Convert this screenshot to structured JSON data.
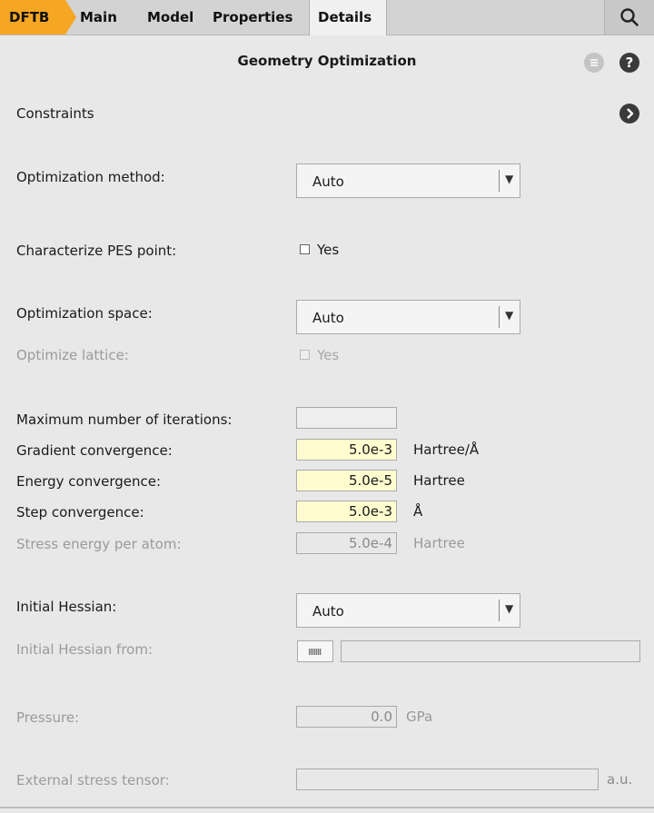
{
  "tabs": {
    "dftb": "DFTB",
    "main": "Main",
    "model": "Model",
    "properties": "Properties",
    "details": "Details"
  },
  "panel": {
    "title": "Geometry Optimization",
    "constraints": "Constraints"
  },
  "fields": {
    "optimization_method": {
      "label": "Optimization method:",
      "value": "Auto"
    },
    "characterize_pes": {
      "label": "Characterize PES point:",
      "checkbox": "Yes",
      "checked": false
    },
    "optimization_space": {
      "label": "Optimization space:",
      "value": "Auto"
    },
    "optimize_lattice": {
      "label": "Optimize lattice:",
      "checkbox": "Yes",
      "checked": false
    },
    "max_iterations": {
      "label": "Maximum number of iterations:",
      "value": ""
    },
    "gradient_convergence": {
      "label": "Gradient convergence:",
      "value": "5.0e-3",
      "unit": "Hartree/Å"
    },
    "energy_convergence": {
      "label": "Energy convergence:",
      "value": "5.0e-5",
      "unit": "Hartree"
    },
    "step_convergence": {
      "label": "Step convergence:",
      "value": "5.0e-3",
      "unit": "Å"
    },
    "stress_energy": {
      "label": "Stress energy per atom:",
      "value": "5.0e-4",
      "unit": "Hartree"
    },
    "initial_hessian": {
      "label": "Initial Hessian:",
      "value": "Auto"
    },
    "initial_hessian_from": {
      "label": "Initial Hessian from:",
      "value": ""
    },
    "pressure": {
      "label": "Pressure:",
      "value": "0.0",
      "unit": "GPa"
    },
    "external_stress": {
      "label": "External stress tensor:",
      "value": "",
      "unit": "a.u."
    }
  },
  "icons": {
    "search": "search-icon",
    "list": "list-icon",
    "help": "help-icon",
    "next": "chevron-right-icon"
  },
  "colors": {
    "accent": "#f5a623",
    "highlight_input": "#fffdd0",
    "background": "#e8e8e8"
  }
}
